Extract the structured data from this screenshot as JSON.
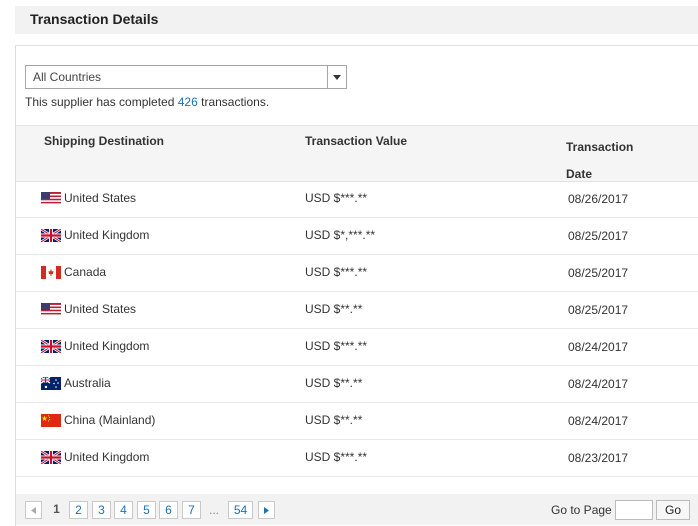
{
  "header": {
    "title": "Transaction Details"
  },
  "filter": {
    "selected": "All Countries",
    "arrow_icon": "caret-down-icon"
  },
  "summary": {
    "prefix": "This supplier has completed ",
    "count": "426",
    "suffix": " transactions."
  },
  "table": {
    "headers": {
      "destination": "Shipping Destination",
      "value": "Transaction Value",
      "date_line1": "Transaction",
      "date_line2": "Date"
    },
    "rows": [
      {
        "flag": "us-flag-icon",
        "country": "United States",
        "value": "USD $***.**",
        "date": "08/26/2017"
      },
      {
        "flag": "uk-flag-icon",
        "country": "United Kingdom",
        "value": "USD $*,***.**",
        "date": "08/25/2017"
      },
      {
        "flag": "ca-flag-icon",
        "country": "Canada",
        "value": "USD $***.**",
        "date": "08/25/2017"
      },
      {
        "flag": "us-flag-icon",
        "country": "United States",
        "value": "USD $**.**",
        "date": "08/25/2017"
      },
      {
        "flag": "uk-flag-icon",
        "country": "United Kingdom",
        "value": "USD $***.**",
        "date": "08/24/2017"
      },
      {
        "flag": "au-flag-icon",
        "country": "Australia",
        "value": "USD $**.**",
        "date": "08/24/2017"
      },
      {
        "flag": "cn-flag-icon",
        "country": "China (Mainland)",
        "value": "USD $**.**",
        "date": "08/24/2017"
      },
      {
        "flag": "uk-flag-icon",
        "country": "United Kingdom",
        "value": "USD $***.**",
        "date": "08/23/2017"
      }
    ]
  },
  "pagination": {
    "pages": [
      "1",
      "2",
      "3",
      "4",
      "5",
      "6",
      "7"
    ],
    "current": "1",
    "ellipsis": "...",
    "last": "54",
    "goto_label": "Go to Page",
    "goto_value": "",
    "go_label": "Go"
  },
  "colors": {
    "link": "#1f6fb5",
    "header_bg": "#f2f2f2"
  }
}
